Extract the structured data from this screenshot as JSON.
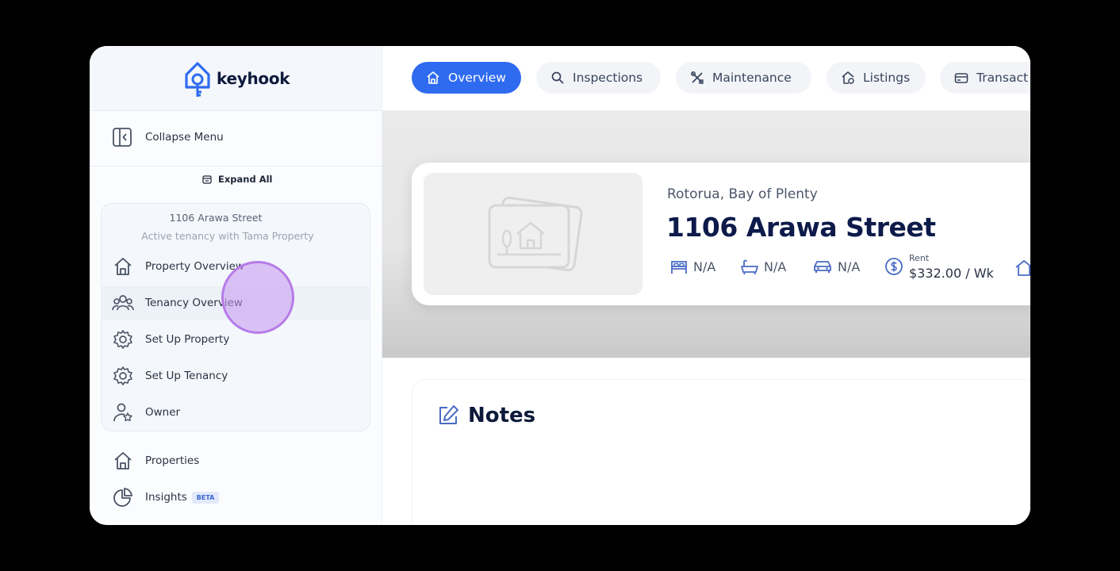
{
  "brand": {
    "name": "keyhook",
    "accent": "#2f6bf0"
  },
  "sidebar": {
    "collapse_label": "Collapse Menu",
    "expand_all_label": "Expand All",
    "property": {
      "address": "1106 Arawa Street",
      "status": "Active tenancy with Tama Property",
      "items": [
        {
          "label": "Property Overview",
          "icon": "home-icon"
        },
        {
          "label": "Tenancy Overview",
          "icon": "users-icon"
        },
        {
          "label": "Set Up Property",
          "icon": "gear-icon"
        },
        {
          "label": "Set Up Tenancy",
          "icon": "gear-icon"
        },
        {
          "label": "Owner",
          "icon": "owner-icon"
        }
      ]
    },
    "nav": [
      {
        "label": "Properties",
        "icon": "home-icon"
      },
      {
        "label": "Insights",
        "icon": "pie-chart-icon",
        "badge": "BETA"
      }
    ]
  },
  "tabs": [
    {
      "label": "Overview",
      "icon": "home-icon",
      "active": true
    },
    {
      "label": "Inspections",
      "icon": "search-icon"
    },
    {
      "label": "Maintenance",
      "icon": "tools-icon"
    },
    {
      "label": "Listings",
      "icon": "listing-icon"
    },
    {
      "label": "Transact",
      "icon": "card-icon"
    }
  ],
  "property": {
    "location": "Rotorua, Bay of Plenty",
    "title": "1106 Arawa Street",
    "bedrooms": "N/A",
    "bathrooms": "N/A",
    "parking": "N/A",
    "rent_label": "Rent",
    "rent_value": "$332.00 / Wk"
  },
  "notes": {
    "title": "Notes"
  }
}
